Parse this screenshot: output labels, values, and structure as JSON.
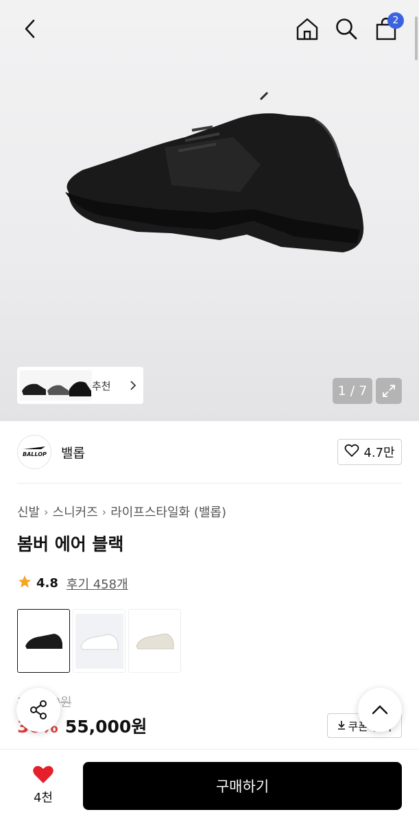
{
  "header": {
    "icons": [
      "back-icon",
      "home-icon",
      "search-icon",
      "cart-icon"
    ],
    "cart_count": "2"
  },
  "gallery": {
    "recommend_label": "추천",
    "pager": "1 / 7"
  },
  "brand": {
    "logo_text": "BALLOP",
    "name": "밸롭",
    "likes": "4.7만"
  },
  "breadcrumb": {
    "items": [
      "신발",
      "스니커즈",
      "라이프스타일화 (밸롭)"
    ]
  },
  "product": {
    "title": "봄버 에어 블랙",
    "rating": "4.8",
    "reviews": "후기 458개",
    "variants": [
      "black",
      "white",
      "beige"
    ]
  },
  "price": {
    "original": "79,000원",
    "discount": "30%",
    "sale": "55,000원",
    "coupon_label": "쿠폰 받기"
  },
  "bottom": {
    "wish_count": "4천",
    "buy_label": "구매하기"
  },
  "colors": {
    "accent_badge": "#3b63e0",
    "discount": "#e03a3a",
    "heart": "#e5202c",
    "buy_button": "#000000"
  }
}
